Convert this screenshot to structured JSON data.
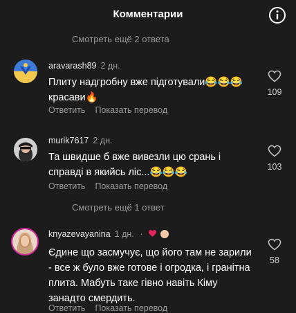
{
  "header": {
    "title": "Комментарии"
  },
  "top_more_replies": "Смотреть ещё 2 ответа",
  "middle_more_replies": "Смотреть ещё 1 ответ",
  "comments": [
    {
      "username": "aravarash89",
      "time": "2 дн.",
      "text": "Плиту надгробну вже підготували😂😂😂красави🔥",
      "likes": "109",
      "reply": "Ответить",
      "translate": "Показать перевод"
    },
    {
      "username": "murik7617",
      "time": "2 дн.",
      "text": "Та швидше б вже вивезли цю срань і справді в якийсь ліс...😂😂😂",
      "likes": "103",
      "reply": "Ответить",
      "translate": "Показать перевод"
    },
    {
      "username": "knyazevayanina",
      "time": "1 дн.",
      "text": "Єдине що засмучує, що його там не зарили - все ж було вже готове і огродка, і гранітна плита. Мабуть таке гівно навіть Кіму занадто смердить.",
      "likes": "58",
      "reply": "Ответить",
      "translate": "Показать перевод",
      "separator": "·"
    }
  ],
  "colors": {
    "background": "#1c1c1c",
    "secondary_text": "#9a9a9a",
    "like_heart": "#e0245e"
  }
}
